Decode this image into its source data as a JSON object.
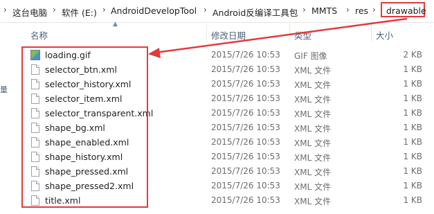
{
  "breadcrumb": {
    "items": [
      "这台电脑",
      "软件 (E:)",
      "AndroidDevelopTool",
      "Android反编译工具包",
      "MMTS",
      "res",
      "drawable"
    ],
    "separator": "›"
  },
  "columns": {
    "name": "名称",
    "date": "修改日期",
    "type": "类型",
    "size": "大小"
  },
  "side_marks": [
    "量"
  ],
  "files": [
    {
      "name": "loading.gif",
      "date": "2015/7/26 10:53",
      "type": "GIF 图像",
      "size": "2 KB",
      "icon": "gif-image-icon"
    },
    {
      "name": "selector_btn.xml",
      "date": "2015/7/26 10:53",
      "type": "XML 文件",
      "size": "1 KB",
      "icon": "xml-file-icon"
    },
    {
      "name": "selector_history.xml",
      "date": "2015/7/26 10:53",
      "type": "XML 文件",
      "size": "1 KB",
      "icon": "xml-file-icon"
    },
    {
      "name": "selector_item.xml",
      "date": "2015/7/26 10:53",
      "type": "XML 文件",
      "size": "1 KB",
      "icon": "xml-file-icon"
    },
    {
      "name": "selector_transparent.xml",
      "date": "2015/7/26 10:53",
      "type": "XML 文件",
      "size": "1 KB",
      "icon": "xml-file-icon"
    },
    {
      "name": "shape_bg.xml",
      "date": "2015/7/26 10:53",
      "type": "XML 文件",
      "size": "1 KB",
      "icon": "xml-file-icon"
    },
    {
      "name": "shape_enabled.xml",
      "date": "2015/7/26 10:53",
      "type": "XML 文件",
      "size": "1 KB",
      "icon": "xml-file-icon"
    },
    {
      "name": "shape_history.xml",
      "date": "2015/7/26 10:53",
      "type": "XML 文件",
      "size": "1 KB",
      "icon": "xml-file-icon"
    },
    {
      "name": "shape_pressed.xml",
      "date": "2015/7/26 10:53",
      "type": "XML 文件",
      "size": "1 KB",
      "icon": "xml-file-icon"
    },
    {
      "name": "shape_pressed2.xml",
      "date": "2015/7/26 10:53",
      "type": "XML 文件",
      "size": "1 KB",
      "icon": "xml-file-icon"
    },
    {
      "name": "title.xml",
      "date": "2015/7/26 10:53",
      "type": "XML 文件",
      "size": "1 KB",
      "icon": "xml-file-icon"
    }
  ],
  "colors": {
    "annotation": "#e23a3a",
    "header_text": "#4c607a",
    "detail_text": "#6d6d6d"
  }
}
